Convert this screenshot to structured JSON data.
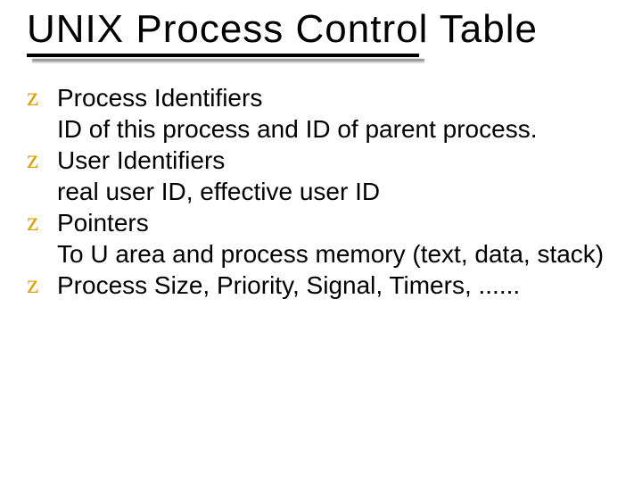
{
  "slide": {
    "title": "UNIX Process Control Table",
    "bullet_glyph": "z",
    "items": [
      {
        "title": "Process Identifiers",
        "desc": "ID of this process and ID of parent process."
      },
      {
        "title": "User Identifiers",
        "desc": "real user ID, effective user ID"
      },
      {
        "title": "Pointers",
        "desc": "To U area and process memory (text, data, stack)"
      },
      {
        "title": "Process Size, Priority, Signal, Timers, ......",
        "desc": ""
      }
    ]
  }
}
